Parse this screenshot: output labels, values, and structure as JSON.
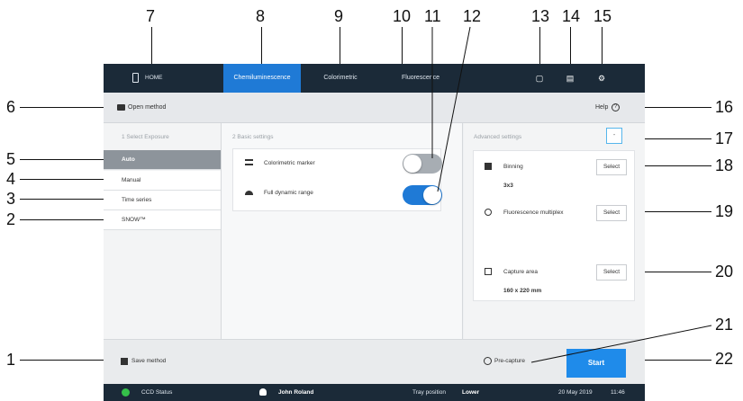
{
  "callouts": [
    "1",
    "2",
    "3",
    "4",
    "5",
    "6",
    "7",
    "8",
    "9",
    "10",
    "11",
    "12",
    "13",
    "14",
    "15",
    "16",
    "17",
    "18",
    "19",
    "20",
    "21",
    "22"
  ],
  "topbar": {
    "home": "HOME",
    "tabs": [
      "Chemiluminescence",
      "Colorimetric",
      "Fluorescence"
    ],
    "active_tab": "Chemiluminescence",
    "icons": [
      "folder-icon",
      "clipboard-icon",
      "gear-icon"
    ]
  },
  "subbar": {
    "open_method": "Open method",
    "help": "Help"
  },
  "left_panel": {
    "header": "1 Select Exposure",
    "items": [
      "Auto",
      "Manual",
      "Time series",
      "SNOW™"
    ],
    "selected": "Auto"
  },
  "mid_panel": {
    "header": "2 Basic settings",
    "settings": [
      {
        "label": "Colorimetric marker",
        "enabled": false
      },
      {
        "label": "Full dynamic range",
        "enabled": true
      }
    ]
  },
  "right_panel": {
    "header": "Advanced settings",
    "collapse": "-",
    "select_label": "Select",
    "binning": {
      "label": "Binning",
      "value": "3x3"
    },
    "multiplex": {
      "label": "Fluorescence multiplex"
    },
    "capture_area": {
      "label": "Capture area",
      "value": "160 x 220 mm"
    }
  },
  "bottombar": {
    "save_method": "Save method",
    "pre_capture": "Pre-capture",
    "start": "Start"
  },
  "statusbar": {
    "ccd": "CCD Status",
    "user": "John Roland",
    "tray_label": "Tray position",
    "tray_value": "Lower",
    "date": "20 May 2019",
    "time": "11:46"
  },
  "colors": {
    "nav": "#1b2a38",
    "accent": "#1f7ad6",
    "start": "#1f8bea",
    "ccd_ok": "#35c14a"
  }
}
